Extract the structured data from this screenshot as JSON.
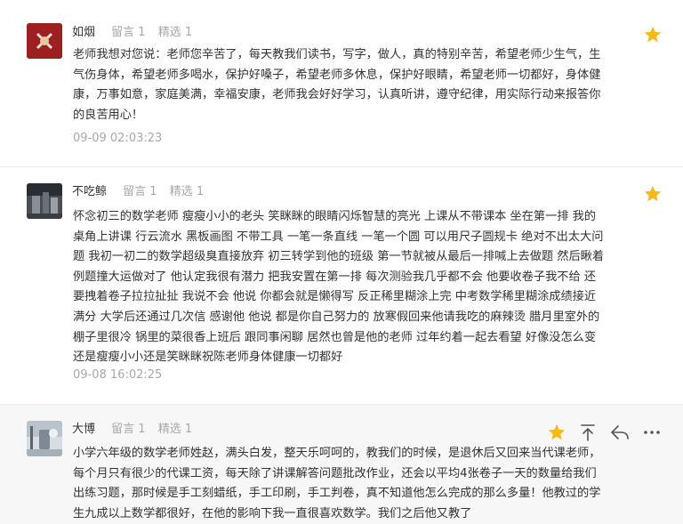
{
  "comments": [
    {
      "name": "如烟",
      "replies": "留言 1",
      "featured": "精选 1",
      "text": "老师我想对您说：老师您辛苦了，每天教我们读书，写字，做人，真的特别辛苦，希望老师少生气，生气伤身体，希望老师多喝水，保护好嗓子，希望老师多休息，保护好眼睛，希望老师一切都好，身体健康，万事如意，家庭美满，幸福安康，老师我会好好学习，认真听讲，遵守纪律，用实际行动来报答你的良苦用心！",
      "time": "09-09 02:03:23"
    },
    {
      "name": "不吃鲸",
      "replies": "留言 1",
      "featured": "精选 1",
      "text": "怀念初三的数学老师 瘦瘦小小的老头 笑眯眯的眼睛闪烁智慧的亮光 上课从不带课本 坐在第一排 我的桌角上讲课 行云流水 黑板画图 不带工具 一笔一条直线 一笔一个圆 可以用尺子圆规卡 绝对不出太大问题 我初一初二的数学超级臭直接放弃 初三转学到他的班级 第一节就被从最后一排喊上去做题 然后瞅着例题撞大运做对了 他认定我很有潜力 把我安置在第一排 每次测验我几乎都不会 他要收卷子我不给 还要拽着卷子拉拉扯扯 我说不会 他说 你都会就是懒得写 反正稀里糊涂上完 中考数学稀里糊涂成绩接近满分 大学后还通过几次信 感谢他 他说 都是你自己努力的 放寒假回来他请我吃的麻辣烫 腊月里室外的棚子里很冷 锅里的菜很香上班后 跟同事闲聊 居然也曾是他的老师 过年约着一起去看望 好像没怎么变 还是瘦瘦小小还是笑眯眯祝陈老师身体健康一切都好",
      "time": "09-08 16:02:25"
    },
    {
      "name": "大博",
      "replies": "留言 1",
      "featured": "精选 1",
      "text": "小学六年级的数学老师姓赵，满头白发，整天乐呵呵的，教我们的时候，是退休后又回来当代课老师，每个月只有很少的代课工资，每天除了讲课解答问题批改作业，还会以平均4张卷子一天的数量给我们出练习题，那时候是手工刻蜡纸，手工印刷，手工判卷，真不知道他怎么完成的那么多量！他教过的学生九成以上数学都很好，在他的影响下我一直很喜欢数学。我们之后他又教了"
    }
  ],
  "icons": [
    "star-icon",
    "pin-top-icon",
    "reply-icon",
    "more-icon"
  ],
  "colors": {
    "star": "#f5b918",
    "meta": "#a8a8a8",
    "text": "#333333",
    "hover_bg": "#f7f7f7"
  }
}
